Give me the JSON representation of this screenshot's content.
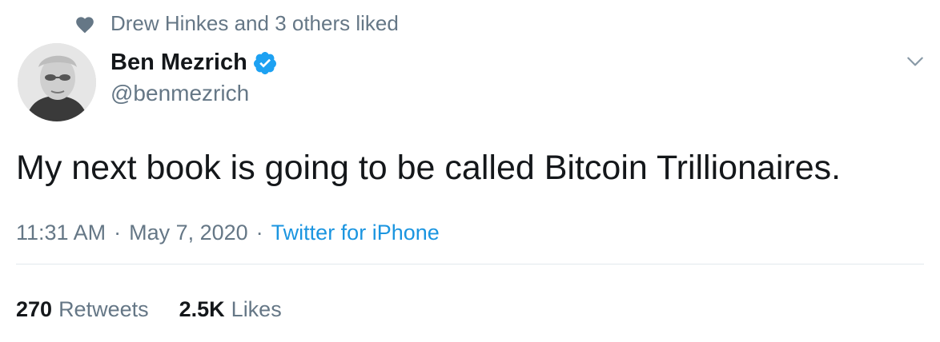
{
  "social_context": {
    "icon": "heart-icon",
    "text": "Drew Hinkes and 3 others liked"
  },
  "author": {
    "display_name": "Ben Mezrich",
    "handle": "@benmezrich",
    "verified_icon": "verified-badge-icon",
    "verified_color": "#1da1f2"
  },
  "tweet": {
    "text": "My next book is going to be called Bitcoin Trillionaires.",
    "time": "11:31 AM",
    "separator": "·",
    "date": "May 7, 2020",
    "source": "Twitter for iPhone"
  },
  "stats": {
    "retweets_count": "270",
    "retweets_label": "Retweets",
    "likes_count": "2.5K",
    "likes_label": "Likes"
  },
  "colors": {
    "text_primary": "#14171a",
    "text_secondary": "#657786",
    "link": "#1b95e0",
    "divider": "#e1e8ed"
  }
}
